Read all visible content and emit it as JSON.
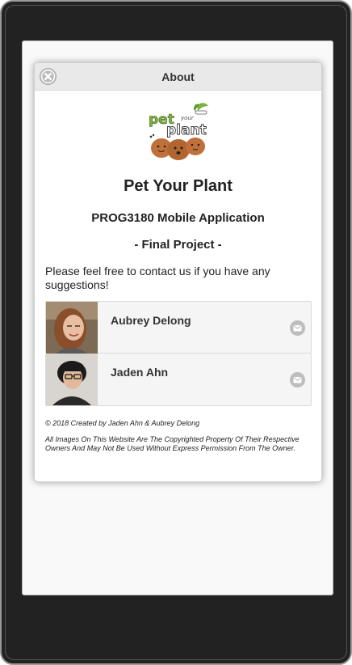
{
  "dialog": {
    "title": "About",
    "close_icon": "close-icon"
  },
  "app": {
    "logo_text_pet": "pet",
    "logo_text_your": "your",
    "logo_text_plant": "plant",
    "title": "Pet Your Plant",
    "subtitle": "PROG3180 Mobile Application",
    "tagline": "- Final Project -"
  },
  "contact": {
    "intro": "Please feel free to contact us if you have any suggestions!"
  },
  "people": [
    {
      "name": "Aubrey Delong",
      "icon": "mail-icon"
    },
    {
      "name": "Jaden Ahn",
      "icon": "mail-icon"
    }
  ],
  "footer": {
    "copyright": "© 2018 Created by Jaden Ahn & Aubrey Delong",
    "disclaimer": "All Images On This Website Are The Copyrighted Property Of Their Respective Owners And May Not Be Used Without Express Permission From The Owner."
  },
  "colors": {
    "device_frame": "#222222",
    "header_bg": "#e9e9e9",
    "icon_gray": "#bdbdbd",
    "logo_green": "#7bb33f",
    "pot_brown": "#c0703a"
  }
}
